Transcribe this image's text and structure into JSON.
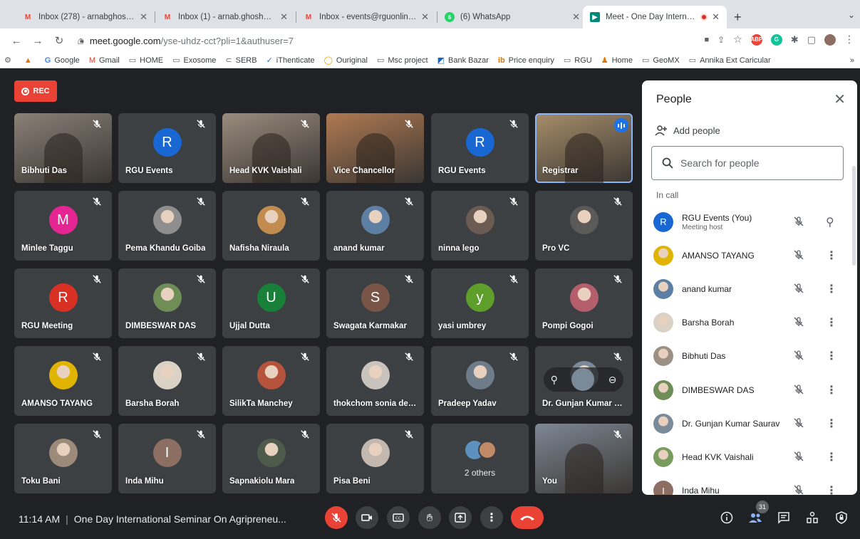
{
  "browser": {
    "tabs": [
      {
        "title": "Inbox (278) - arnabghosh.mail…",
        "icon": "gmail-icon",
        "active": false
      },
      {
        "title": "Inbox (1) - arnab.ghosh@rgu.ac",
        "icon": "gmail-icon",
        "active": false
      },
      {
        "title": "Inbox - events@rguonline.in - R",
        "icon": "gmail-icon",
        "active": false
      },
      {
        "title": "(6) WhatsApp",
        "icon": "whatsapp-icon",
        "active": false
      },
      {
        "title": "Meet - One Day Internation",
        "icon": "meet-icon",
        "active": true
      }
    ],
    "url_host": "meet.google.com",
    "url_path": "/yse-uhdz-cct?pli=1&authuser=7",
    "bookmarks": [
      "Google",
      "Gmail",
      "HOME",
      "Exosome",
      "SERB",
      "iThenticate",
      "Ouriginal",
      "Msc project",
      "Bank Bazar",
      "Price enquiry",
      "RGU",
      "Home",
      "GeoMX",
      "Annika Ext Caricular"
    ],
    "extensions": [
      {
        "name": "abp-extension-icon",
        "label": "ABP",
        "color": "#e8453c"
      },
      {
        "name": "grammarly-extension-icon",
        "label": "G",
        "color": "#15c39a"
      }
    ]
  },
  "meet": {
    "recording_label": "REC",
    "tiles": [
      {
        "name": "Bibhuti Das",
        "kind": "video",
        "bg": "#8a8177"
      },
      {
        "name": "RGU Events",
        "kind": "letter",
        "letter": "R",
        "color": "#1967d2"
      },
      {
        "name": "Head KVK Vaishali",
        "kind": "video",
        "bg": "#9a8c7e"
      },
      {
        "name": "Vice Chancellor",
        "kind": "video",
        "bg": "#b07a52"
      },
      {
        "name": "RGU Events",
        "kind": "letter",
        "letter": "R",
        "color": "#1967d2"
      },
      {
        "name": "Registrar",
        "kind": "video",
        "bg": "#a78e6a",
        "speaking": true
      },
      {
        "name": "Minlee Taggu",
        "kind": "letter",
        "letter": "M",
        "color": "#e52592"
      },
      {
        "name": "Pema Khandu Goiba",
        "kind": "photo",
        "color": "#8e8e8e"
      },
      {
        "name": "Nafisha Niraula",
        "kind": "photo",
        "color": "#c28b4f"
      },
      {
        "name": "anand kumar",
        "kind": "photo",
        "color": "#5d7fa3"
      },
      {
        "name": "ninna lego",
        "kind": "photo",
        "color": "#6b5b52"
      },
      {
        "name": "Pro VC",
        "kind": "photo",
        "color": "#5c5a58"
      },
      {
        "name": "RGU Meeting",
        "kind": "letter",
        "letter": "R",
        "color": "#d93025"
      },
      {
        "name": "DIMBESWAR DAS",
        "kind": "photo",
        "color": "#6f8d56"
      },
      {
        "name": "Ujjal Dutta",
        "kind": "letter",
        "letter": "U",
        "color": "#188038"
      },
      {
        "name": "Swagata Karmakar",
        "kind": "letter",
        "letter": "S",
        "color": "#795548"
      },
      {
        "name": "yasi umbrey",
        "kind": "letter",
        "letter": "y",
        "color": "#5e9e2a"
      },
      {
        "name": "Pompi Gogoi",
        "kind": "photo",
        "color": "#b45f6b"
      },
      {
        "name": "AMANSO TAYANG",
        "kind": "photo",
        "color": "#e0b400"
      },
      {
        "name": "Barsha Borah",
        "kind": "photo",
        "color": "#d9d2c5"
      },
      {
        "name": "SilikTa Manchey",
        "kind": "photo",
        "color": "#b5533c"
      },
      {
        "name": "thokchom sonia de…",
        "kind": "photo",
        "color": "#c9c3bd"
      },
      {
        "name": "Pradeep Yadav",
        "kind": "photo",
        "color": "#6e7c8a"
      },
      {
        "name": "Dr. Gunjan Kumar …",
        "kind": "hover",
        "color": "#7b8a99"
      },
      {
        "name": "Toku Bani",
        "kind": "photo",
        "color": "#9c8a7a"
      },
      {
        "name": "Inda Mihu",
        "kind": "letter",
        "letter": "I",
        "color": "#8d6e63"
      },
      {
        "name": "Sapnakiolu Mara",
        "kind": "photo",
        "color": "#4f5b4a"
      },
      {
        "name": "Pisa Beni",
        "kind": "photo",
        "color": "#c2b8b0"
      },
      {
        "name": "",
        "kind": "others",
        "others_label": "2 others"
      },
      {
        "name": "You",
        "kind": "video",
        "bg": "#7d8794"
      }
    ],
    "people_panel": {
      "title": "People",
      "add_people": "Add people",
      "search_placeholder": "Search for people",
      "section": "In call",
      "participants": [
        {
          "name": "RGU Events (You)",
          "sub": "Meeting host",
          "letter": "R",
          "color": "#1967d2",
          "action": "pin-icon"
        },
        {
          "name": "AMANSO TAYANG",
          "sub": "",
          "letter": "",
          "color": "#e0b400",
          "action": "more-icon"
        },
        {
          "name": "anand kumar",
          "sub": "",
          "letter": "",
          "color": "#5d7fa3",
          "action": "more-icon"
        },
        {
          "name": "Barsha Borah",
          "sub": "",
          "letter": "",
          "color": "#d9d2c5",
          "action": "more-icon"
        },
        {
          "name": "Bibhuti Das",
          "sub": "",
          "letter": "",
          "color": "#9c8f84",
          "action": "more-icon"
        },
        {
          "name": "DIMBESWAR DAS",
          "sub": "",
          "letter": "",
          "color": "#6f8d56",
          "action": "more-icon"
        },
        {
          "name": "Dr. Gunjan Kumar Saurav",
          "sub": "",
          "letter": "",
          "color": "#7b8a99",
          "action": "more-icon"
        },
        {
          "name": "Head KVK Vaishali",
          "sub": "",
          "letter": "",
          "color": "#7a9b5e",
          "action": "more-icon"
        },
        {
          "name": "Inda Mihu",
          "sub": "",
          "letter": "I",
          "color": "#8d6e63",
          "action": "more-icon"
        }
      ]
    },
    "bottom_bar": {
      "time": "11:14 AM",
      "meeting_title": "One Day International Seminar On Agripreneu...",
      "participant_count": "31"
    }
  }
}
